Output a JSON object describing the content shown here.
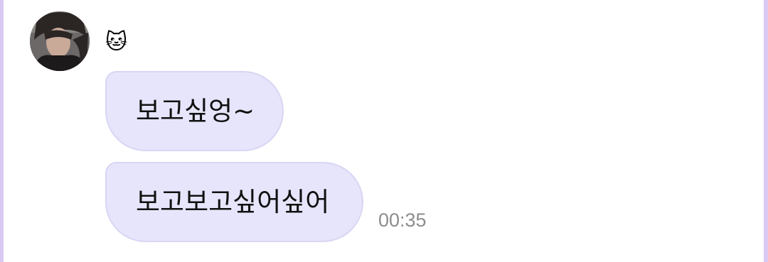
{
  "message_group": {
    "sender": {
      "name": "🐱",
      "avatar": "profile-photo"
    },
    "messages": [
      {
        "text": "보고싶엉~"
      },
      {
        "text": "보고보고싶어싶어",
        "time": "00:35"
      }
    ]
  },
  "colors": {
    "bubble_fill": "#e6e5fb",
    "bubble_border": "#d8d6f3",
    "edge": "#d9c9f3",
    "timestamp": "#8d8d8d"
  }
}
